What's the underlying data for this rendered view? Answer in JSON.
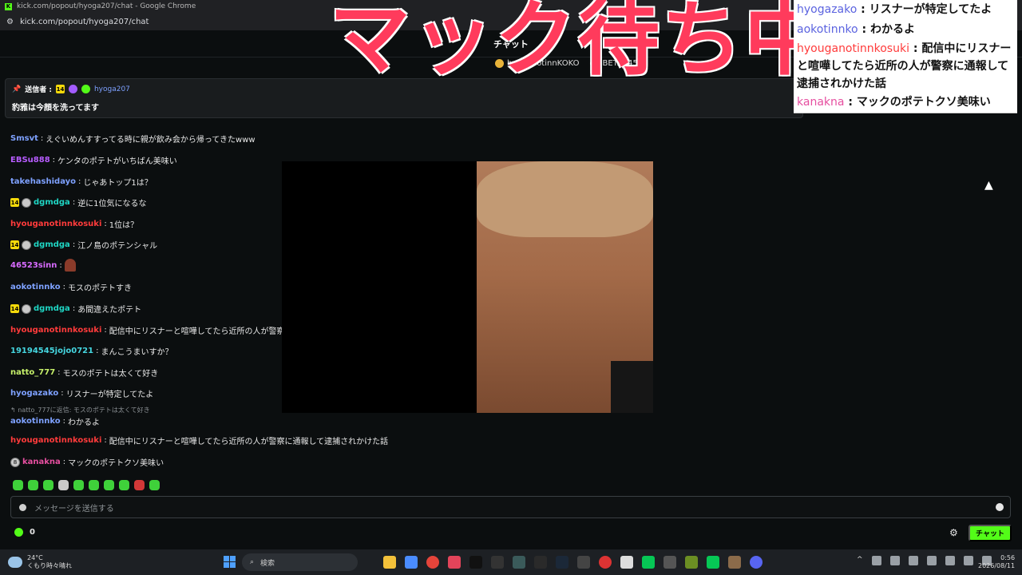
{
  "browser": {
    "window_title": "kick.com/popout/hyoga207/chat - Google Chrome",
    "url": "kick.com/popout/hyoga207/chat"
  },
  "chat": {
    "header_title": "チャット",
    "top_gifters": [
      {
        "name": "hyoganotinnKOKO",
        "color": "#e8b339"
      },
      {
        "name": "BETA1456",
        "color": "#bbbbbb"
      }
    ],
    "pinned": {
      "sender_label": "送信者 :",
      "sub_badge": "14",
      "user": "hyoga207",
      "text": "豹雅は今顔を洗ってます"
    },
    "messages": [
      {
        "user": "Smsvt",
        "color": "#7ea1ff",
        "text": "えぐいめんすすってる時に親が飲み会から帰ってきたwww"
      },
      {
        "user": "EBSu888",
        "color": "#b75cff",
        "text": "ケンタのポテトがいちばん美味い"
      },
      {
        "user": "takehashidayo",
        "color": "#7ea1ff",
        "text": "じゃあトップ1は？"
      },
      {
        "user": "dgmdga",
        "color": "#1fd6c4",
        "badge": "14",
        "text": "逆に1位気になるな"
      },
      {
        "user": "hyouganotinnkosuki",
        "color": "#ff3b3b",
        "text": "1位は？"
      },
      {
        "user": "dgmdga",
        "color": "#1fd6c4",
        "badge": "14",
        "text": "江ノ島のポテンシャル"
      },
      {
        "user": "46523sinn",
        "color": "#d86bff",
        "text": ""
      },
      {
        "user": "aokotinnko",
        "color": "#7ea1ff",
        "text": "モスのポテトすき"
      },
      {
        "user": "dgmdga",
        "color": "#1fd6c4",
        "badge": "14",
        "text": "あ間違えたポテト"
      },
      {
        "user": "hyouganotinnkosuki",
        "color": "#ff3b3b",
        "text": "配信中にリスナーと喧嘩してたら近所の人が警察に通報して逮捕されかけた話おもろかったから話して欲しい"
      },
      {
        "user": "19194545jojo0721",
        "color": "#45d6e0",
        "text": "まんこうまいすか？"
      },
      {
        "user": "natto_777",
        "color": "#c6f06a",
        "text": "モスのポテトは太くて好き"
      },
      {
        "user": "hyogazako",
        "color": "#7ea1ff",
        "text": "リスナーが特定してたよ"
      },
      {
        "user": "aokotinnko",
        "color": "#7ea1ff",
        "text": "わかるよ",
        "reply": "natto_777に返信: モスのポテトは太くて好き"
      },
      {
        "user": "hyouganotinnkosuki",
        "color": "#ff3b3b",
        "text": "配信中にリスナーと喧嘩してたら近所の人が警察に通報して逮捕されかけた話"
      },
      {
        "user": "kanakna",
        "color": "#e64fa0",
        "text": "マックのポテトクソ美味い",
        "badge": "8"
      }
    ],
    "input_placeholder": "メッセージを送信する",
    "points": "0",
    "send_label": "チャット"
  },
  "overlay": {
    "title": "マック待ち中",
    "chat_lines": [
      {
        "user": "hyogazako",
        "text": "リスナーが特定してたよ"
      },
      {
        "user": "aokotinnko",
        "text": "わかるよ"
      },
      {
        "user": "hyouganotinnkosuki",
        "text": "配信中にリスナーと喧嘩してたら近所の人が警察に通報して逮捕されかけた話"
      },
      {
        "user": "kanakna",
        "text": "マックのポテトクソ美味い"
      }
    ]
  },
  "taskbar": {
    "temperature": "24°C",
    "weather": "くもり時々晴れ",
    "search": "検索",
    "time": "0:56",
    "date": "2026/08/11"
  }
}
